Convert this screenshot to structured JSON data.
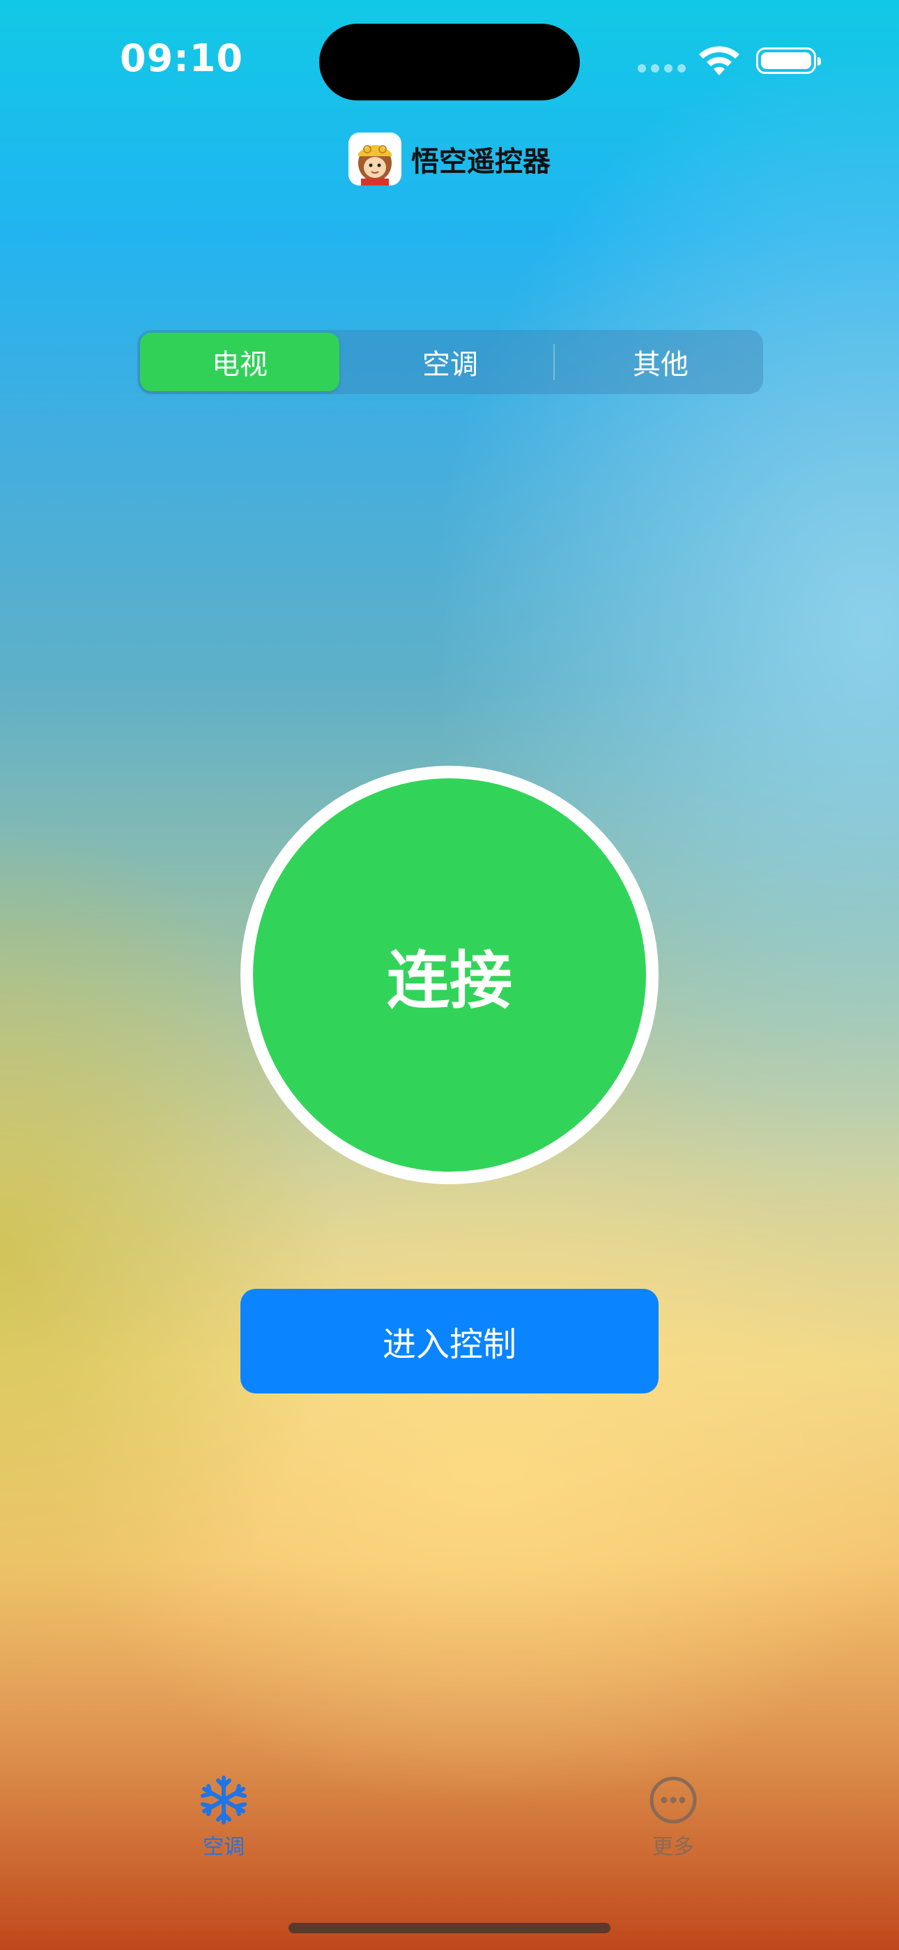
{
  "status_bar": {
    "time": "09:10"
  },
  "header": {
    "title": "悟空遥控器"
  },
  "segmented": {
    "tabs": [
      "电视",
      "空调",
      "其他"
    ],
    "selected": "电视"
  },
  "main": {
    "connect_label": "连接",
    "enter_label": "进入控制"
  },
  "tab_bar": {
    "items": [
      {
        "label": "空调",
        "icon": "snowflake-icon",
        "active": true
      },
      {
        "label": "更多",
        "icon": "more-icon",
        "active": false
      }
    ]
  },
  "colors": {
    "accent_green": "#31d459",
    "accent_blue": "#0a84ff"
  }
}
